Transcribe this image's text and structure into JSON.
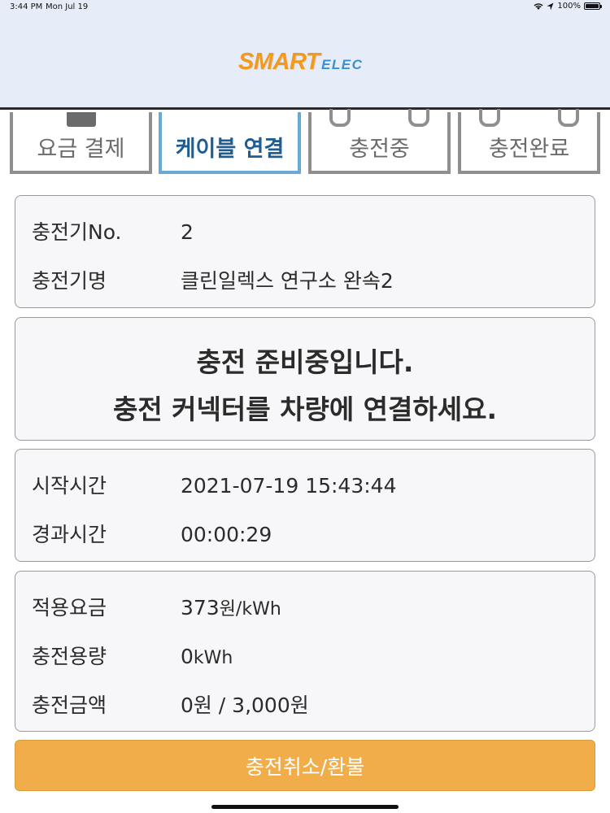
{
  "status_bar": {
    "time": "3:44 PM",
    "date": "Mon Jul 19",
    "battery": "100%",
    "icons": [
      "wifi-icon",
      "location-icon",
      "battery-icon"
    ]
  },
  "header": {
    "logo_main": "SMART",
    "logo_sub": "ELEC"
  },
  "steps": [
    {
      "label": "요금 결제",
      "active": false
    },
    {
      "label": "케이블 연결",
      "active": true
    },
    {
      "label": "충전중",
      "active": false
    },
    {
      "label": "충전완료",
      "active": false
    }
  ],
  "charger_info": {
    "number_label": "충전기No.",
    "number_value": "2",
    "name_label": "충전기명",
    "name_value": "클린일렉스 연구소 완속2"
  },
  "notice": {
    "line1": "충전 준비중입니다.",
    "line2": "충전 커넥터를 차량에 연결하세요."
  },
  "time_info": {
    "start_label": "시작시간",
    "start_value": "2021-07-19 15:43:44",
    "elapsed_label": "경과시간",
    "elapsed_value": "00:00:29"
  },
  "charge_info": {
    "rate_label": "적용요금",
    "rate_value": "373",
    "rate_unit": "원/kWh",
    "amount_label": "충전용량",
    "amount_value": "0",
    "amount_unit": "kWh",
    "cost_label": "충전금액",
    "cost_value": "0원 / 3,000원"
  },
  "actions": {
    "cancel_label": "충전취소/환불"
  },
  "colors": {
    "header_bg": "#e6edf8",
    "active_step": "#6aa9d6",
    "button": "#f2ad4b",
    "logo_orange": "#f39a1c",
    "logo_blue": "#3a8fd0"
  }
}
